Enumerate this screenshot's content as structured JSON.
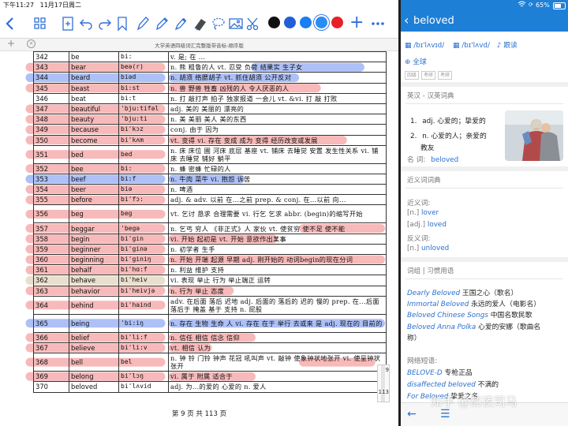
{
  "left_status": {
    "time": "下午11:27",
    "date": "11月17日周二"
  },
  "doc_title": "大学英语四级词汇完整版带音标-顺序版",
  "rows": [
    {
      "num": "342",
      "word": "be",
      "phon": "bi:",
      "def": "v. 是; 在 ..."
    },
    {
      "num": "343",
      "word": "bear",
      "phon": "beə(r)",
      "def": "n. 熊  粗鲁的人 vt. 忍受  负荷  结果实 生子女"
    },
    {
      "num": "344",
      "word": "beard",
      "phon": "biəd",
      "def": "n. 胡须  络腮胡子  vt. 抓住胡须  公开反对"
    },
    {
      "num": "345",
      "word": "beast",
      "phon": "bi:st",
      "def": "n. 兽  野兽  牲畜  凶残的人  令人厌恶的人"
    },
    {
      "num": "346",
      "word": "beat",
      "phon": "bi:t",
      "def": "n. 打  敲打声  拍子  独家报道  一会儿 vt. &vi. 打  敲  打败"
    },
    {
      "num": "347",
      "word": "beautiful",
      "phon": "'bju:tifəl",
      "def": "adj. 美的  美丽的  漂亮的"
    },
    {
      "num": "348",
      "word": "beauty",
      "phon": "'bju:ti",
      "def": "n. 美  美丽  美人  美的东西"
    },
    {
      "num": "349",
      "word": "because",
      "phon": "bi'kɔz",
      "def": "conj. 由于  因为"
    },
    {
      "num": "350",
      "word": "become",
      "phon": "bi'kʌm",
      "def": "vt. 变得  vi. 存在  变成  成为  变得  经历改变或发展"
    },
    {
      "num": "351",
      "word": "bed",
      "phon": "bed",
      "def": "n. 床  床位  圃  河床  底层  基座  vt. 铺床  去睡觉  安置  发生性关系  vi. 铺床  去睡觉  铺好  躺平"
    },
    {
      "num": "352",
      "word": "bee",
      "phon": "bi:",
      "def": "n. 蜂  密蜂  忙碌的人"
    },
    {
      "num": "353",
      "word": "beef",
      "phon": "bi:f",
      "def": "n. 牛肉  菜牛  vi. 抱怨  诉苦"
    },
    {
      "num": "354",
      "word": "beer",
      "phon": "biə",
      "def": "n. 啤酒"
    },
    {
      "num": "355",
      "word": "before",
      "phon": "bi'fɔ:",
      "def": "adj. & adv. 以前  在...之前 prep. & conj. 在...以前  向..."
    },
    {
      "num": "356",
      "word": "beg",
      "phon": "beg",
      "def": "vt. 乞讨  恳求  合理需要  vi. 行乞  乞求 abbr. (begin)的缩写开始"
    },
    {
      "num": "357",
      "word": "beggar",
      "phon": "'begə",
      "def": "n. 乞丐  穷人 《非正式》人  家伙  vt. 使贫穷  使不足  使不能"
    },
    {
      "num": "358",
      "word": "begin",
      "phon": "bi'gin",
      "def": "vi. 开始  起初是  vt. 开始  意欲作出某事"
    },
    {
      "num": "359",
      "word": "beginner",
      "phon": "bi'ginə",
      "def": "n. 初学者  生手"
    },
    {
      "num": "360",
      "word": "beginning",
      "phon": "bi'giniŋ",
      "def": "n. 开始  开端  起源  早期 adj. 刚开始的 动词begin的现在分词"
    },
    {
      "num": "361",
      "word": "behalf",
      "phon": "bi'hɑ:f",
      "def": "n. 利益  维护  支持"
    },
    {
      "num": "362",
      "word": "behave",
      "phon": "bi'heiv",
      "def": "vi. 表现  举止  行为  举止端正  运转"
    },
    {
      "num": "363",
      "word": "behavior",
      "phon": "bi'heivjə",
      "def": "n. 行为  举止  态度"
    },
    {
      "num": "364",
      "word": "behind",
      "phon": "bi'haind",
      "def": "adv. 在后面  落后  迟地 adj. 后面的  落后的  迟的  慢的 prep. 在...后面  落后于  掩盖  基于  支持 n. 屁股"
    },
    {
      "num": "365",
      "word": "being",
      "phon": "'bi:iŋ",
      "def": "n. 存在  生物  生命  人 vi. 存在  在于  举行  去或来  是 adj. 现在的  目前的"
    },
    {
      "num": "366",
      "word": "belief",
      "phon": "bi'li:f",
      "def": "n. 信任  相信  信念  信仰"
    },
    {
      "num": "367",
      "word": "believe",
      "phon": "bi'li:v",
      "def": "vt. 相信  认为"
    },
    {
      "num": "368",
      "word": "bell",
      "phon": "bel",
      "def": "n. 钟  铃  门铃  钟声  花冠  吼叫声 vt. 敲钟 使象钟状地张开 vi. 使呈钟状  张开"
    },
    {
      "num": "369",
      "word": "belong",
      "phon": "bi'lɔŋ",
      "def": "vi. 属于  附属  适合于"
    },
    {
      "num": "370",
      "word": "beloved",
      "phon": "bi'lʌvid",
      "def": "adj. 为...的爱的  心爱的 n. 爱人"
    }
  ],
  "footer": {
    "page_label": "第 9 页  共 113 页"
  },
  "scroll": {
    "top": "9",
    "bottom": "113"
  },
  "right_status": {
    "battery": "65%"
  },
  "dict": {
    "word": "beloved",
    "uk_flag": "英",
    "us_flag": "美",
    "phon_uk": "/bɪ'lʌvɪd/",
    "phon_us": "/bɪ'lʌvd/",
    "follow": "跟读",
    "global": "全球",
    "tags": [
      "四级",
      "考研",
      "考研"
    ],
    "section_enzh": "英汉 - 汉英词典",
    "defs": [
      {
        "n": "1.",
        "text": "adj. 心爱的；挚爱的"
      },
      {
        "n": "2.",
        "text": "n. 心爱的人；亲爱的"
      },
      {
        "n": "",
        "text": "教友"
      }
    ],
    "noun_label": "名  词:",
    "noun_value": "beloved",
    "section_syn": "近义词词典",
    "syn_label": "近义词:",
    "syn": [
      {
        "pos": "[n.]",
        "word": "lover"
      },
      {
        "pos": "[adj.]",
        "word": "loved"
      }
    ],
    "ant_label": "反义词:",
    "ant": [
      {
        "pos": "[n.]",
        "word": "unloved"
      }
    ],
    "section_phrases": "词组 | 习惯用语",
    "phrases": [
      {
        "en": "Dearly Beloved",
        "zh": "王国之心（歌名）"
      },
      {
        "en": "Immortal Beloved",
        "zh": "永远的爱人（电影名）"
      },
      {
        "en": "Beloved Chinese Songs",
        "zh": "中国名歌民歌"
      },
      {
        "en": "Beloved Anna Polka",
        "zh": "心爱的安娜（歌曲名"
      },
      {
        "en": "",
        "zh": "称）"
      }
    ],
    "web_label": "网络短语:",
    "web": [
      {
        "en": "BELOVE-D",
        "zh": "专枪正品"
      },
      {
        "en": "disaffected beloved",
        "zh": "不满的"
      },
      {
        "en": "For Beloved",
        "zh": "挚爱之名"
      }
    ]
  },
  "watermark": "知乎 @熬夜司马",
  "colors": {
    "accent": "#1e7fd6",
    "red_highlight": "#f08080",
    "blue_highlight": "#6a8cf0",
    "tan_highlight": "#d6c6a6"
  }
}
